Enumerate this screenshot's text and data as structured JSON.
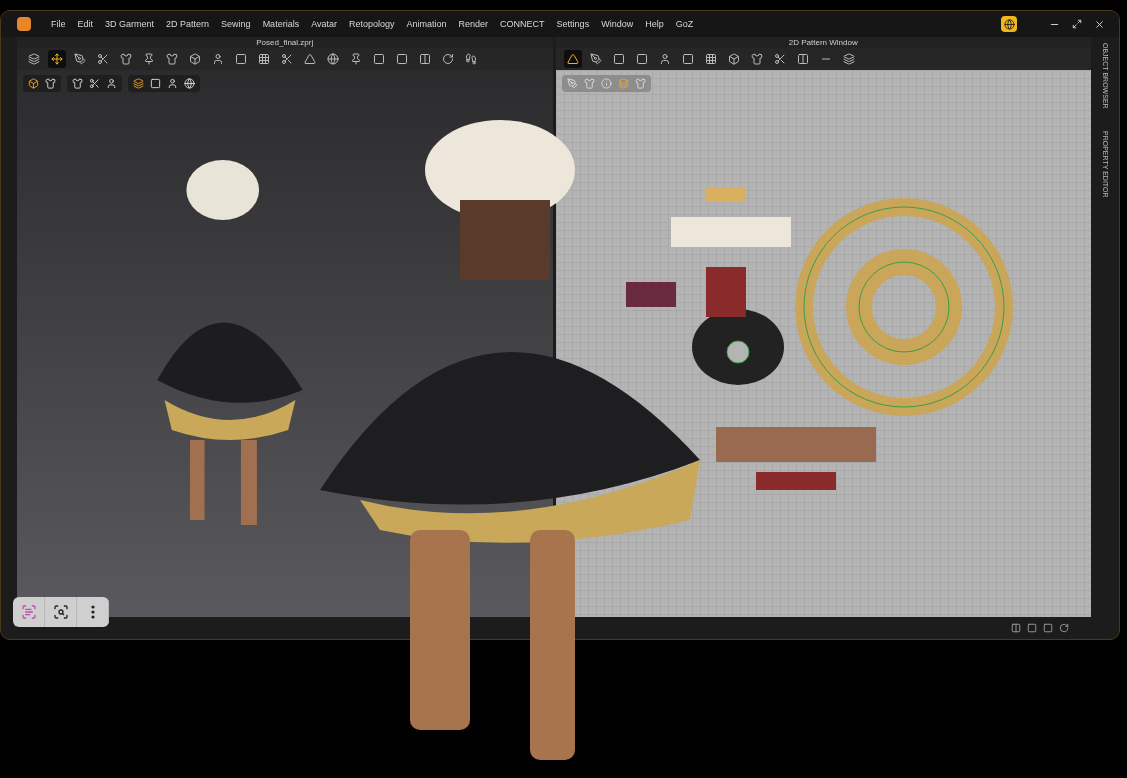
{
  "menu": [
    "File",
    "Edit",
    "3D Garment",
    "2D Pattern",
    "Sewing",
    "Materials",
    "Avatar",
    "Retopology",
    "Animation",
    "Render",
    "CONNECT",
    "Settings",
    "Window",
    "Help",
    "GoZ"
  ],
  "viewport_3d": {
    "title": "Posed_final.zprj",
    "tools": [
      {
        "selected": false
      },
      {
        "selected": true
      },
      {
        "selected": false
      },
      {
        "selected": false
      },
      {
        "selected": false
      },
      {
        "selected": false
      },
      {
        "selected": false
      },
      {
        "selected": false
      },
      {
        "selected": false
      },
      {
        "selected": false
      },
      {
        "selected": false
      },
      {
        "selected": false
      },
      {
        "selected": false
      },
      {
        "selected": false
      },
      {
        "selected": false
      },
      {
        "selected": false
      },
      {
        "selected": false
      },
      {
        "selected": false
      },
      {
        "selected": false
      },
      {
        "selected": false
      }
    ]
  },
  "viewport_2d": {
    "title": "2D Pattern Window",
    "tools": [
      {
        "selected": true
      },
      {
        "selected": false
      },
      {
        "selected": false
      },
      {
        "selected": false
      },
      {
        "selected": false
      },
      {
        "selected": false
      },
      {
        "selected": false
      },
      {
        "selected": false
      },
      {
        "selected": false
      },
      {
        "selected": false
      },
      {
        "selected": false
      },
      {
        "selected": false
      },
      {
        "selected": false
      }
    ]
  },
  "side_tabs": [
    "OBJECT BROWSER",
    "PROPERTY EDITOR"
  ]
}
